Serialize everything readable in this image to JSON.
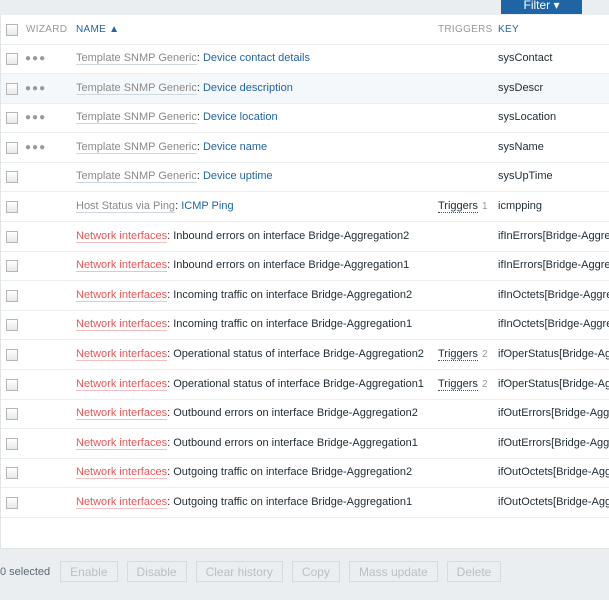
{
  "filter_label": "Filter ▾",
  "header": {
    "wizard": "WIZARD",
    "name": "NAME ▲",
    "triggers": "TRIGGERS",
    "key": "KEY"
  },
  "rows": [
    {
      "prefix": "Template SNMP Generic",
      "name": "Device contact details",
      "key": "sysContact",
      "wizard": true,
      "style": "grey"
    },
    {
      "prefix": "Template SNMP Generic",
      "name": "Device description",
      "key": "sysDescr",
      "wizard": true,
      "style": "grey"
    },
    {
      "prefix": "Template SNMP Generic",
      "name": "Device location",
      "key": "sysLocation",
      "wizard": true,
      "style": "grey"
    },
    {
      "prefix": "Template SNMP Generic",
      "name": "Device name",
      "key": "sysName",
      "wizard": true,
      "style": "grey"
    },
    {
      "prefix": "Template SNMP Generic",
      "name": "Device uptime",
      "key": "sysUpTime",
      "wizard": false,
      "style": "grey"
    },
    {
      "prefix": "Host Status via Ping",
      "name": "ICMP Ping",
      "key": "icmpping",
      "wizard": false,
      "style": "grey",
      "triggers": "Triggers",
      "trigger_count": "1"
    },
    {
      "prefix": "Network interfaces",
      "name": "Inbound errors on interface Bridge-Aggregation2",
      "key": "ifInErrors[Bridge-Aggreg",
      "style": "red"
    },
    {
      "prefix": "Network interfaces",
      "name": "Inbound errors on interface Bridge-Aggregation1",
      "key": "ifInErrors[Bridge-Aggreg",
      "style": "red"
    },
    {
      "prefix": "Network interfaces",
      "name": "Incoming traffic on interface Bridge-Aggregation2",
      "key": "ifInOctets[Bridge-Aggre",
      "style": "red"
    },
    {
      "prefix": "Network interfaces",
      "name": "Incoming traffic on interface Bridge-Aggregation1",
      "key": "ifInOctets[Bridge-Aggre",
      "style": "red"
    },
    {
      "prefix": "Network interfaces",
      "name": "Operational status of interface Bridge-Aggregation2",
      "key": "ifOperStatus[Bridge-Ag",
      "style": "red",
      "triggers": "Triggers",
      "trigger_count": "2"
    },
    {
      "prefix": "Network interfaces",
      "name": "Operational status of interface Bridge-Aggregation1",
      "key": "ifOperStatus[Bridge-Ag",
      "style": "red",
      "triggers": "Triggers",
      "trigger_count": "2"
    },
    {
      "prefix": "Network interfaces",
      "name": "Outbound errors on interface Bridge-Aggregation2",
      "key": "ifOutErrors[Bridge-Aggr",
      "style": "red"
    },
    {
      "prefix": "Network interfaces",
      "name": "Outbound errors on interface Bridge-Aggregation1",
      "key": "ifOutErrors[Bridge-Aggr",
      "style": "red"
    },
    {
      "prefix": "Network interfaces",
      "name": "Outgoing traffic on interface Bridge-Aggregation2",
      "key": "ifOutOctets[Bridge-Aggr",
      "style": "red"
    },
    {
      "prefix": "Network interfaces",
      "name": "Outgoing traffic on interface Bridge-Aggregation1",
      "key": "ifOutOctets[Bridge-Aggr",
      "style": "red"
    }
  ],
  "footer": {
    "selected": "0 selected",
    "buttons": [
      "Enable",
      "Disable",
      "Clear history",
      "Copy",
      "Mass update",
      "Delete"
    ]
  }
}
